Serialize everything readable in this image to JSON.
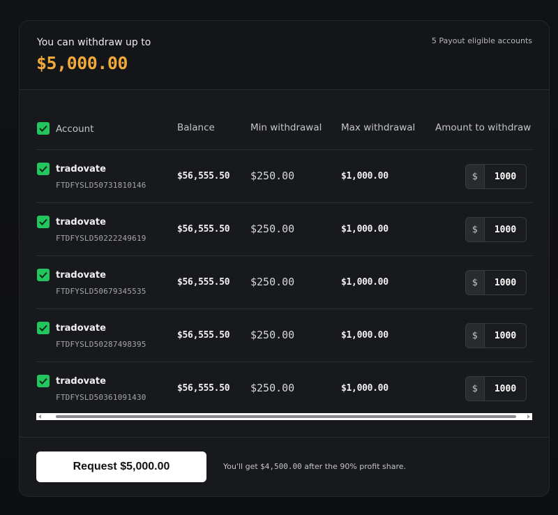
{
  "header": {
    "withdraw_label": "You can withdraw up to",
    "withdraw_amount": "$5,000.00",
    "eligible_text": "5 Payout eligible accounts"
  },
  "table": {
    "columns": {
      "account": "Account",
      "balance": "Balance",
      "min": "Min withdrawal",
      "max": "Max withdrawal",
      "amount": "Amount to withdraw"
    },
    "currency_symbol": "$",
    "rows": [
      {
        "name": "tradovate",
        "id": "FTDFYSLD50731810146",
        "balance": "$56,555.50",
        "min": "$250.00",
        "max": "$1,000.00",
        "amount": "1000",
        "checked": true
      },
      {
        "name": "tradovate",
        "id": "FTDFYSLD50222249619",
        "balance": "$56,555.50",
        "min": "$250.00",
        "max": "$1,000.00",
        "amount": "1000",
        "checked": true
      },
      {
        "name": "tradovate",
        "id": "FTDFYSLD50679345535",
        "balance": "$56,555.50",
        "min": "$250.00",
        "max": "$1,000.00",
        "amount": "1000",
        "checked": true
      },
      {
        "name": "tradovate",
        "id": "FTDFYSLD50287498395",
        "balance": "$56,555.50",
        "min": "$250.00",
        "max": "$1,000.00",
        "amount": "1000",
        "checked": true
      },
      {
        "name": "tradovate",
        "id": "FTDFYSLD50361091430",
        "balance": "$56,555.50",
        "min": "$250.00",
        "max": "$1,000.00",
        "amount": "1000",
        "checked": true
      }
    ]
  },
  "footer": {
    "request_label": "Request $5,000.00",
    "note_prefix": "You'll get ",
    "note_amount": "$4,500.00",
    "note_suffix": " after the 90% profit share."
  },
  "colors": {
    "accent_amount": "#f0a93b",
    "checkbox": "#22c55e"
  }
}
